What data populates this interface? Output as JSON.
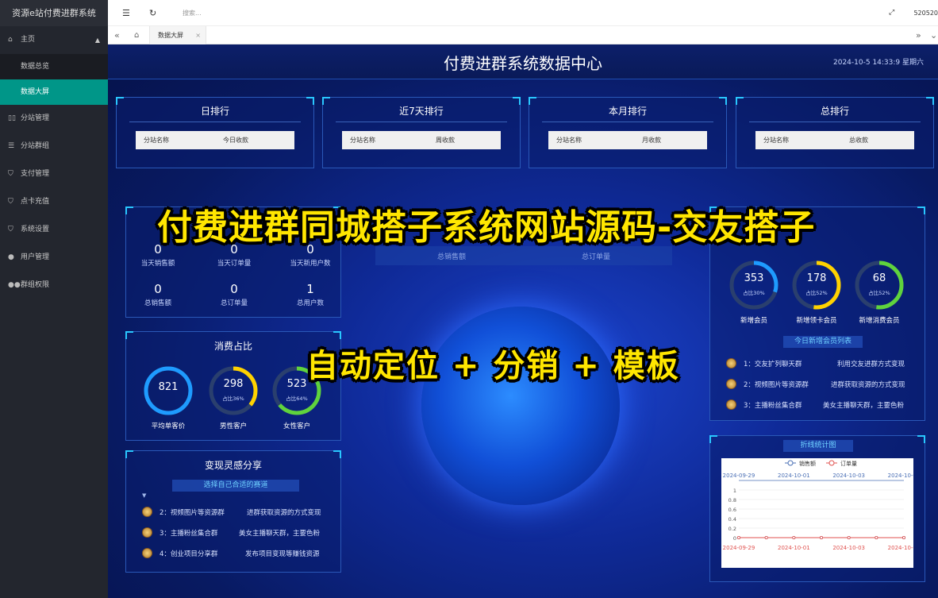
{
  "sidebar": {
    "title": "资源e站付费进群系统",
    "main": "主页",
    "subs": [
      "数据总览",
      "数据大屏"
    ],
    "items": [
      "分站管理",
      "分站群组",
      "支付管理",
      "点卡充值",
      "系统设置",
      "用户管理",
      "群组权限"
    ]
  },
  "topbar": {
    "search_placeholder": "搜索...",
    "user_id": "520520"
  },
  "tabs": {
    "active": "数据大屏",
    "close": "×"
  },
  "screen": {
    "title": "付费进群系统数据中心",
    "time": "2024-10-5 14:33:9 星期六"
  },
  "rank": [
    {
      "title": "日排行",
      "c1": "分站名称",
      "c2": "今日收款"
    },
    {
      "title": "近7天排行",
      "c1": "分站名称",
      "c2": "周收款"
    },
    {
      "title": "本月排行",
      "c1": "分站名称",
      "c2": "月收款"
    },
    {
      "title": "总排行",
      "c1": "分站名称",
      "c2": "总收款"
    }
  ],
  "stats": [
    {
      "v": "0",
      "l": "当天销售额"
    },
    {
      "v": "0",
      "l": "当天订单量"
    },
    {
      "v": "0",
      "l": "当天新用户数"
    },
    {
      "v": "0",
      "l": "总销售额"
    },
    {
      "v": "0",
      "l": "总订单量"
    },
    {
      "v": "1",
      "l": "总用户数"
    }
  ],
  "center_labels": [
    "总销售额",
    "总订单量"
  ],
  "consume": {
    "title": "消费占比",
    "rings": [
      {
        "v": "821",
        "sub": "",
        "l": "平均单客价",
        "pct": 1.0,
        "color": "#1e9bff"
      },
      {
        "v": "298",
        "sub": "占比36%",
        "l": "男性客户",
        "pct": 0.36,
        "color": "#ffd200"
      },
      {
        "v": "523",
        "sub": "占比64%",
        "l": "女性客户",
        "pct": 0.64,
        "color": "#5fd33d"
      }
    ]
  },
  "inspire": {
    "title": "变现灵感分享",
    "subtitle": "选择自己合适的赛道",
    "rows": [
      {
        "a": "2：视频图片等资源群",
        "b": "进群获取资源的方式变现"
      },
      {
        "a": "3：主播粉丝集合群",
        "b": "美女主播聊天群，主要色粉"
      },
      {
        "a": "4：创业项目分享群",
        "b": "发布项目变现等赚钱资源"
      }
    ]
  },
  "members": {
    "rings": [
      {
        "v": "353",
        "sub": "占比30%",
        "l": "新增会员",
        "pct": 0.3,
        "color": "#1e9bff"
      },
      {
        "v": "178",
        "sub": "占比52%",
        "l": "新增领卡会员",
        "pct": 0.52,
        "color": "#ffd200"
      },
      {
        "v": "68",
        "sub": "占比52%",
        "l": "新增消费会员",
        "pct": 0.52,
        "color": "#5fd33d"
      }
    ],
    "list_title": "今日新增会员列表",
    "rows": [
      {
        "a": "1：交友扩列聊天群",
        "b": "利用交友进群方式变现"
      },
      {
        "a": "2：视频图片等资源群",
        "b": "进群获取资源的方式变现"
      },
      {
        "a": "3：主播粉丝集合群",
        "b": "美女主播聊天群，主要色粉"
      }
    ]
  },
  "line_chart": {
    "title": "折线统计图"
  },
  "chart_data": {
    "type": "line",
    "x": [
      "2024-09-29",
      "2024-09-30",
      "2024-10-01",
      "2024-10-02",
      "2024-10-03",
      "2024-10-04",
      "2024-10-05"
    ],
    "x_tick_labels": [
      "2024-09-29",
      "2024-10-01",
      "2024-10-03",
      "2024-10-05"
    ],
    "series": [
      {
        "name": "销售额",
        "values": [
          0,
          0,
          0,
          0,
          0,
          0,
          0
        ],
        "color": "#4a6fb5"
      },
      {
        "name": "订单量",
        "values": [
          0,
          0,
          0,
          0,
          0,
          0,
          0
        ],
        "color": "#e0524f"
      }
    ],
    "ylim": [
      0,
      1
    ],
    "y_ticks": [
      "0",
      "0.2",
      "0.4",
      "0.6",
      "0.8",
      "1"
    ]
  },
  "overlay": {
    "line1": "付费进群同城搭子系统网站源码-交友搭子",
    "line2": "自动定位 + 分销 + 模板"
  }
}
